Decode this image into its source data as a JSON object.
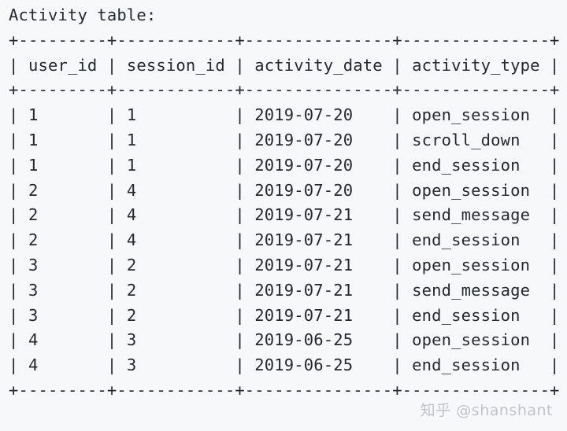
{
  "caption": "Activity table:",
  "separator": "+---------+------------+---------------+---------------+",
  "header_row": "| user_id | session_id | activity_date | activity_type |",
  "rows": [
    "| 1       | 1          | 2019-07-20    | open_session  |",
    "| 1       | 1          | 2019-07-20    | scroll_down   |",
    "| 1       | 1          | 2019-07-20    | end_session   |",
    "| 2       | 4          | 2019-07-20    | open_session  |",
    "| 2       | 4          | 2019-07-21    | send_message  |",
    "| 2       | 4          | 2019-07-21    | end_session   |",
    "| 3       | 2          | 2019-07-21    | open_session  |",
    "| 3       | 2          | 2019-07-21    | send_message  |",
    "| 3       | 2          | 2019-07-21    | end_session   |",
    "| 4       | 3          | 2019-06-25    | open_session  |",
    "| 4       | 3          | 2019-06-25    | end_session   |"
  ],
  "watermark": "知乎 @shanshant"
}
